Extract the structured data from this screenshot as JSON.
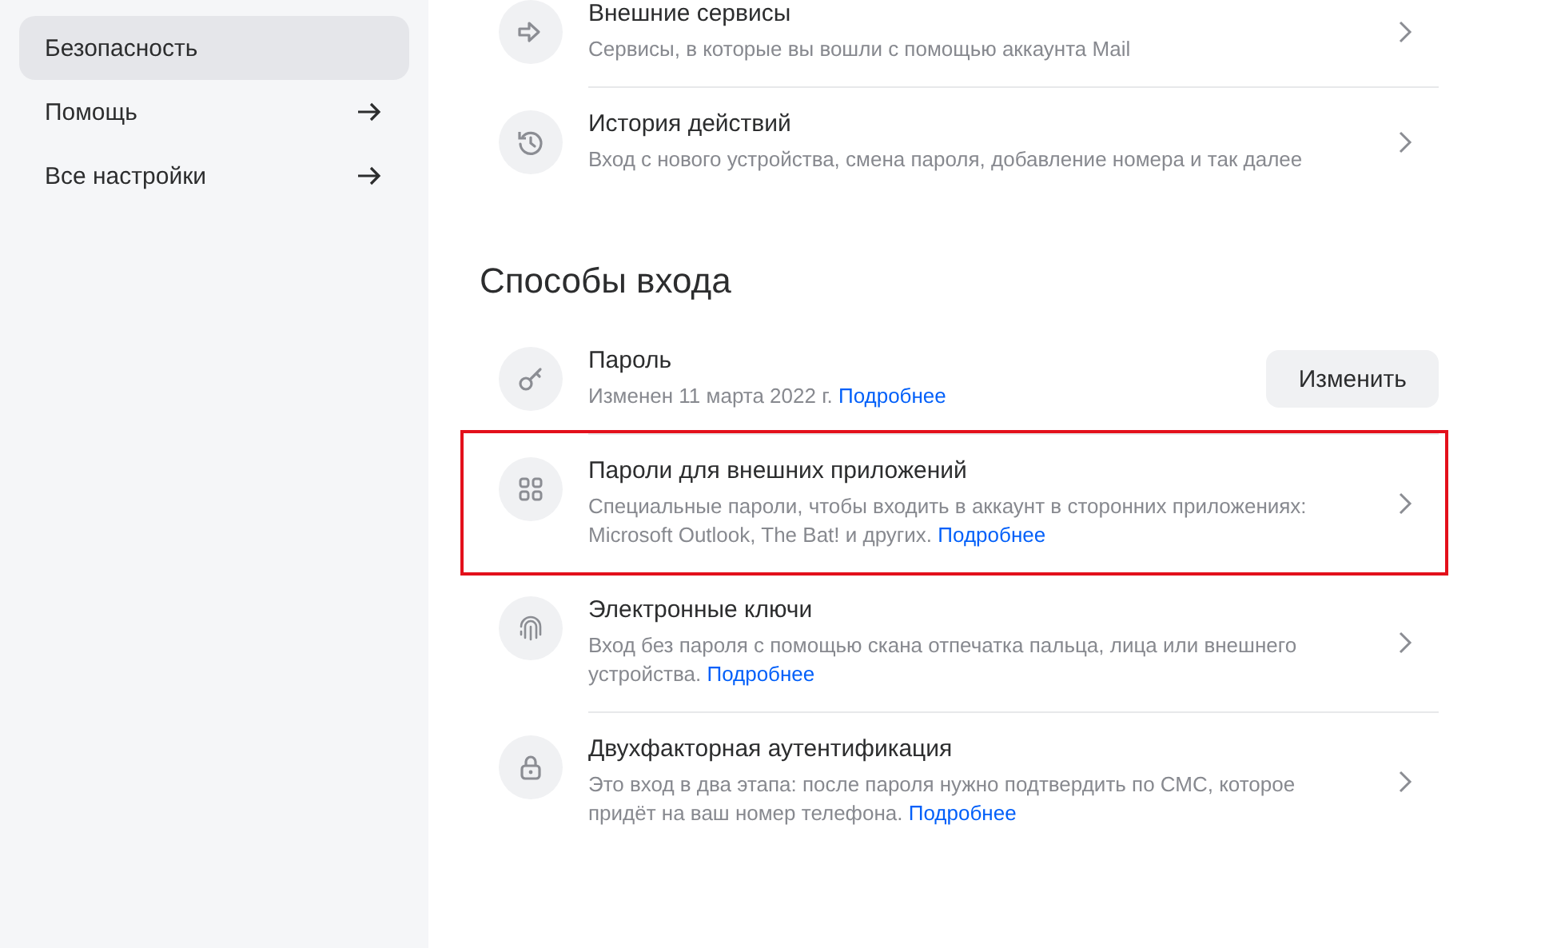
{
  "sidebar": {
    "items": [
      {
        "label": "Безопасность",
        "selected": true,
        "arrow": false
      },
      {
        "label": "Помощь",
        "selected": false,
        "arrow": true
      },
      {
        "label": "Все настройки",
        "selected": false,
        "arrow": true
      }
    ]
  },
  "sections": [
    {
      "rows": [
        {
          "title": "Внешние сервисы",
          "description": "Сервисы, в которые вы вошли с помощью аккаунта Mail",
          "kind": "chevron",
          "highlighted": false
        },
        {
          "title": "История действий",
          "description": "Вход с нового устройства, смена пароля, добавление номера и так далее",
          "kind": "chevron",
          "highlighted": false
        }
      ]
    },
    {
      "heading": "Способы входа",
      "rows": [
        {
          "title": "Пароль",
          "description": "Изменен 11 марта 2022 г.",
          "link": "Подробнее",
          "kind": "button",
          "button": "Изменить",
          "highlighted": false
        },
        {
          "title": "Пароли для внешних приложений",
          "description": "Специальные пароли, чтобы входить в аккаунт в сторонних приложениях: Microsoft Outlook, The Bat! и других.",
          "link": "Подробнее",
          "kind": "chevron",
          "highlighted": true
        },
        {
          "title": "Электронные ключи",
          "description": "Вход без пароля с помощью скана отпечатка пальца, лица или внешнего устройства.",
          "link": "Подробнее",
          "kind": "chevron",
          "highlighted": false
        },
        {
          "title": "Двухфакторная аутентификация",
          "description": "Это вход в два этапа: после пароля нужно подтвердить по СМС, которое придёт на ваш номер телефона.",
          "link": "Подробнее",
          "kind": "chevron",
          "highlighted": false
        }
      ]
    }
  ]
}
